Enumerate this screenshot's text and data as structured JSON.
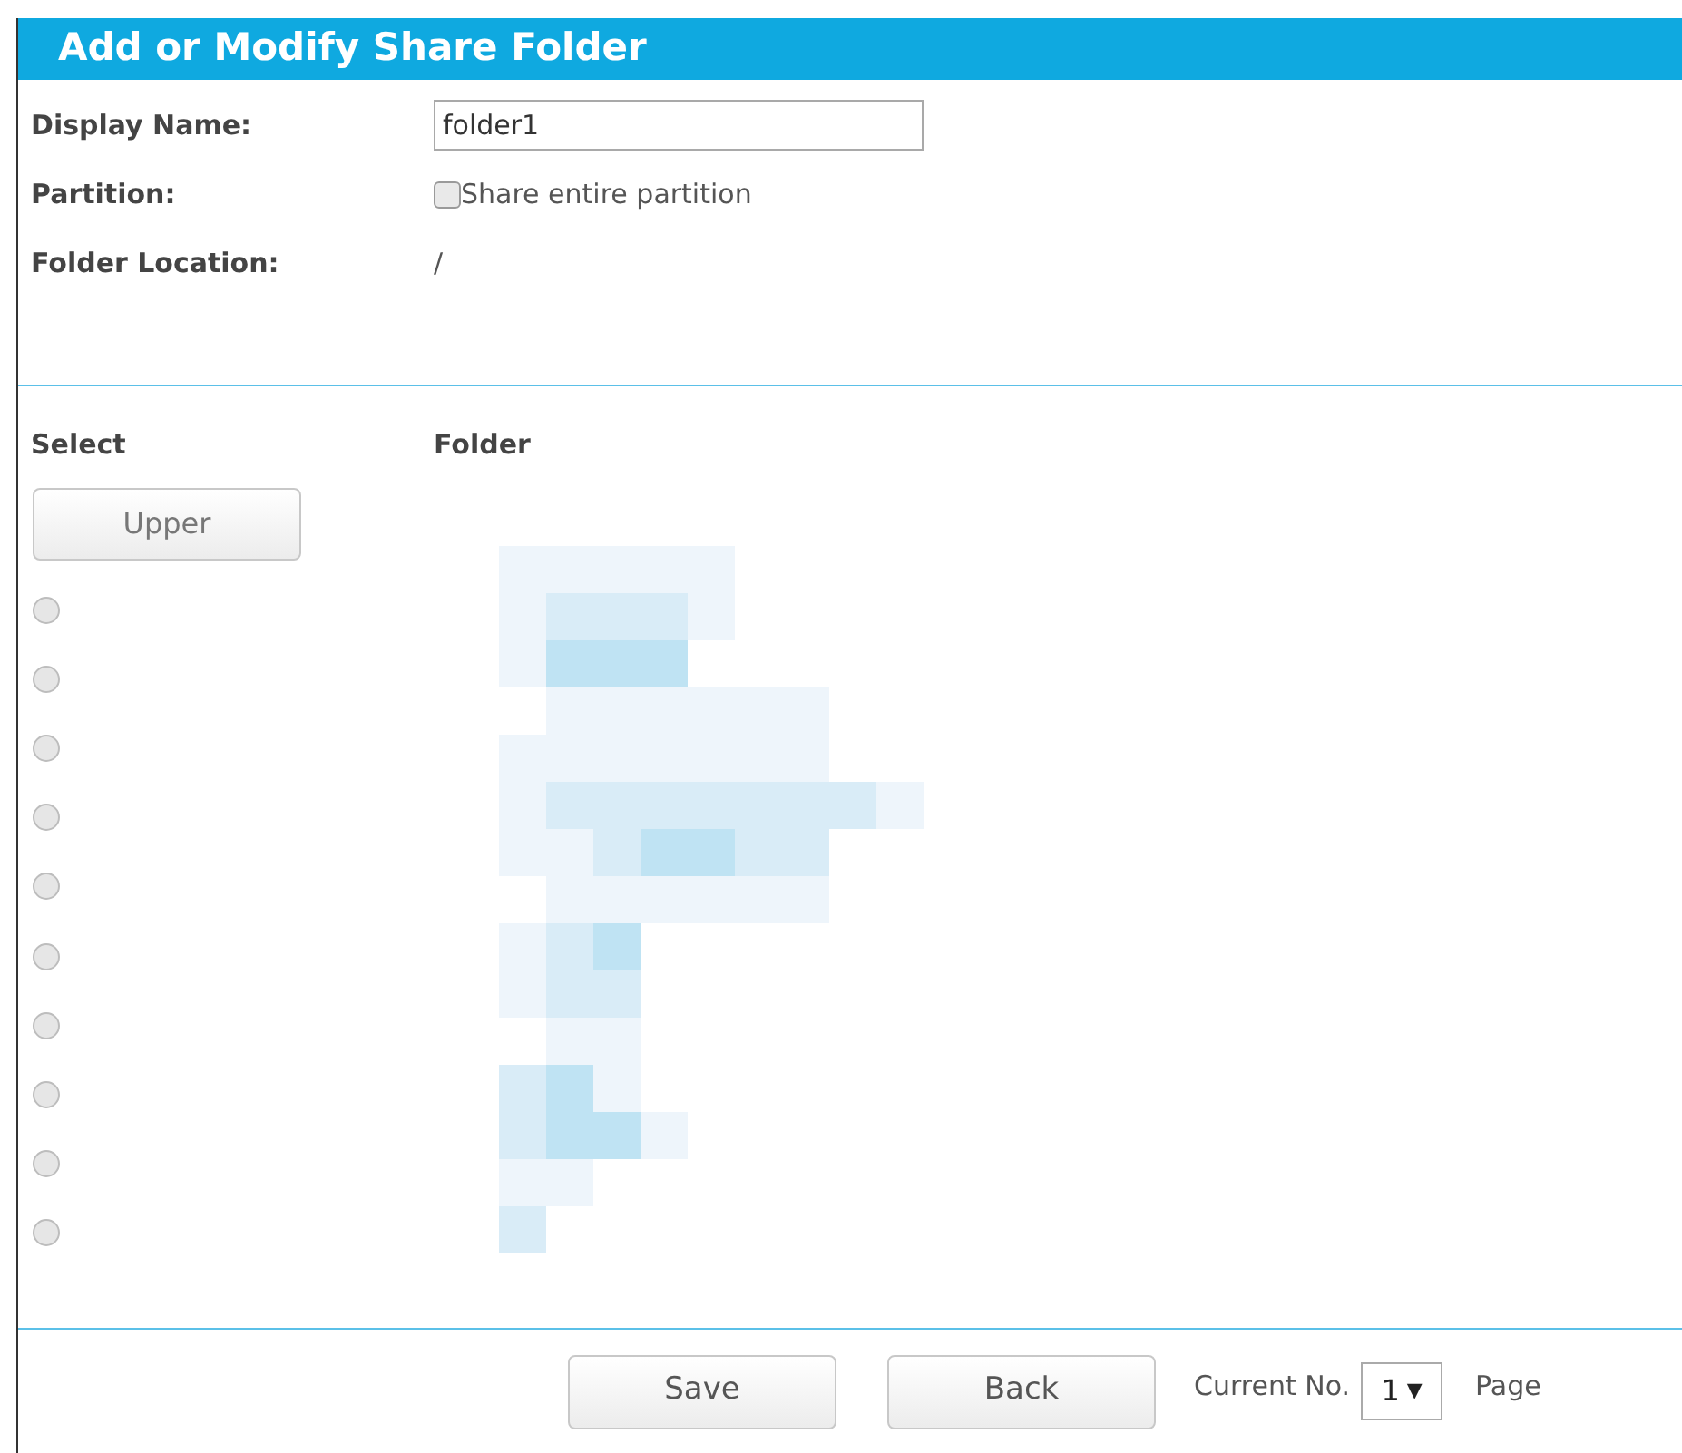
{
  "title": "Add or Modify Share Folder",
  "fields": [
    {
      "label": "Display Name:",
      "kind": "input",
      "value": "folder1"
    },
    {
      "label": "Partition:",
      "kind": "checkbox",
      "text": "Share entire partition",
      "checked": false
    },
    {
      "label": "Folder Location:",
      "kind": "text",
      "text": "/"
    }
  ],
  "columns": [
    "Select",
    "Folder"
  ],
  "upper_button": "Upper",
  "rows": [
    {
      "selected": false
    },
    {
      "selected": false
    },
    {
      "selected": false
    },
    {
      "selected": false
    },
    {
      "selected": false
    },
    {
      "selected": false
    },
    {
      "selected": false
    },
    {
      "selected": false
    },
    {
      "selected": false
    },
    {
      "selected": false
    }
  ],
  "buttons": [
    "Save",
    "Back"
  ],
  "pager": {
    "label": "Current No.",
    "value": "1",
    "arrow": "▼",
    "suffix": "Page"
  }
}
